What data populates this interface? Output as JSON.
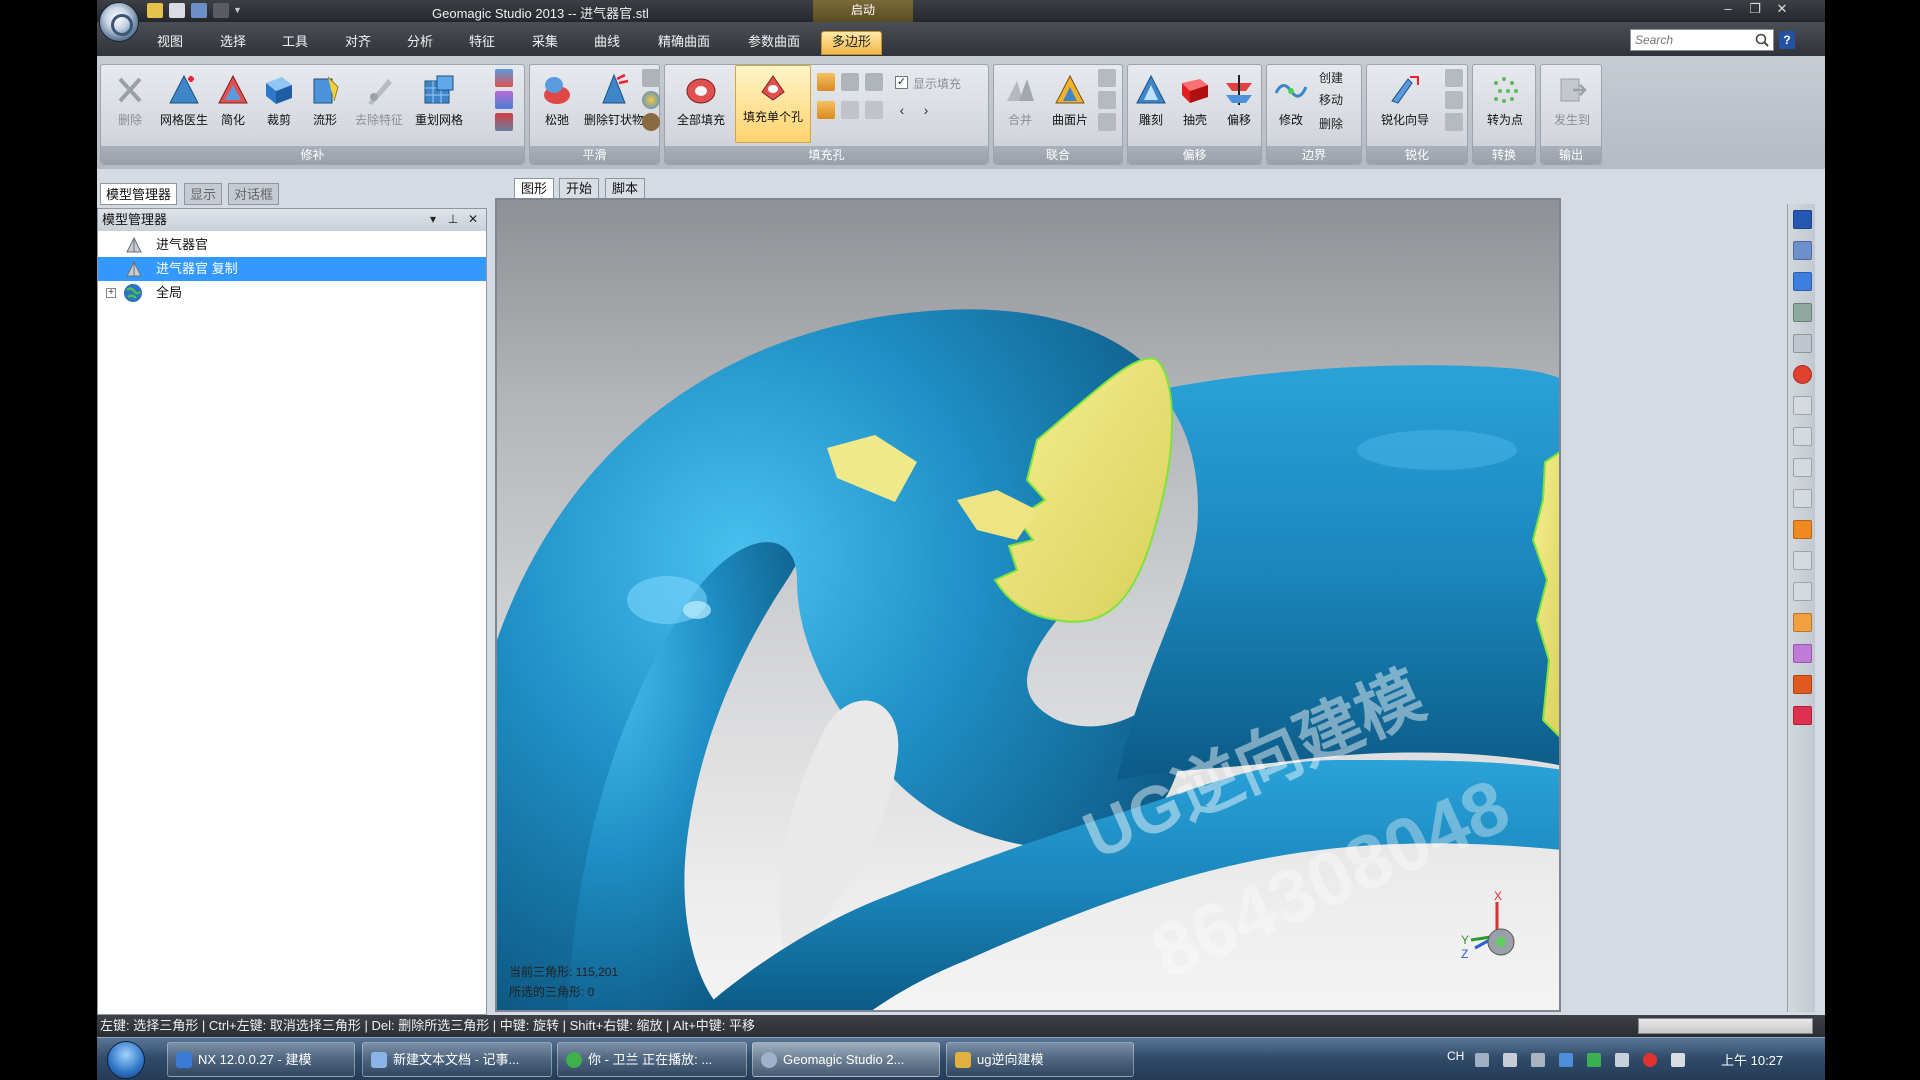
{
  "titlebar": {
    "title": "Geomagic Studio 2013 -- 进气器官.stl",
    "context_tab_title": "启动"
  },
  "menu": {
    "tabs": [
      "视图",
      "选择",
      "工具",
      "对齐",
      "分析",
      "特征",
      "采集",
      "曲线",
      "精确曲面",
      "参数曲面",
      "多边形"
    ],
    "active_tab": "多边形"
  },
  "search": {
    "placeholder": "Search"
  },
  "ribbon": {
    "groups": {
      "repair": {
        "label": "修补",
        "buttons": [
          "删除",
          "网格医生",
          "简化",
          "裁剪",
          "流形",
          "去除特征",
          "重划网格"
        ]
      },
      "smooth": {
        "label": "平滑",
        "buttons": [
          "松弛",
          "删除钉状物"
        ]
      },
      "fill": {
        "label": "填充孔",
        "buttons": [
          "全部填充",
          "填充单个孔"
        ],
        "checkbox_label": "显示填充",
        "checkbox_checked": true
      },
      "merge": {
        "label": "联合",
        "buttons": [
          "合并",
          "曲面片"
        ]
      },
      "offset": {
        "label": "偏移",
        "buttons": [
          "雕刻",
          "抽壳",
          "偏移"
        ]
      },
      "boundary": {
        "label": "边界",
        "buttons": [
          "修改"
        ],
        "small_buttons": [
          "创建",
          "移动",
          "删除"
        ]
      },
      "sharpen": {
        "label": "锐化",
        "buttons": [
          "锐化向导"
        ]
      },
      "convert": {
        "label": "转换",
        "buttons": [
          "转为点"
        ]
      },
      "output": {
        "label": "输出",
        "buttons": [
          "发生到"
        ]
      }
    }
  },
  "panel": {
    "tabs": [
      "模型管理器",
      "显示",
      "对话框"
    ],
    "header": "模型管理器",
    "tree": [
      {
        "label": "进气器官",
        "selected": false
      },
      {
        "label": "进气器官 复制",
        "selected": true
      },
      {
        "label": "全局",
        "selected": false,
        "expander": "+"
      }
    ]
  },
  "viewport": {
    "tabs": [
      "图形",
      "开始",
      "脚本"
    ],
    "triangle_count": "当前三角形: 115,201",
    "selected_count": "所选的三角形: 0",
    "watermark": [
      "UG逆向建模",
      "864308048"
    ],
    "axis_labels": {
      "x": "X",
      "y": "Y",
      "z": "Z"
    },
    "colors": {
      "mesh": "#1f8fc0",
      "fill": "#e8e07a",
      "edge": "#7ee33a"
    }
  },
  "statusbar": {
    "text": "左键: 选择三角形 | Ctrl+左键: 取消选择三角形 | Del: 删除所选三角形 | 中键: 旋转 | Shift+右键: 缩放 | Alt+中键: 平移"
  },
  "taskbar": {
    "items": [
      {
        "label": "NX 12.0.0.27 - 建模",
        "color": "#3a7bd5"
      },
      {
        "label": "新建文本文档 - 记事...",
        "color": "#8ab4e8"
      },
      {
        "label": "你 - 卫兰 正在播放: ...",
        "color": "#3fb04a"
      },
      {
        "label": "Geomagic Studio 2...",
        "color": "#9eb3cc"
      },
      {
        "label": "ug逆向建模",
        "color": "#e0b040"
      }
    ],
    "ime": "CH",
    "clock": "上午 10:27"
  }
}
